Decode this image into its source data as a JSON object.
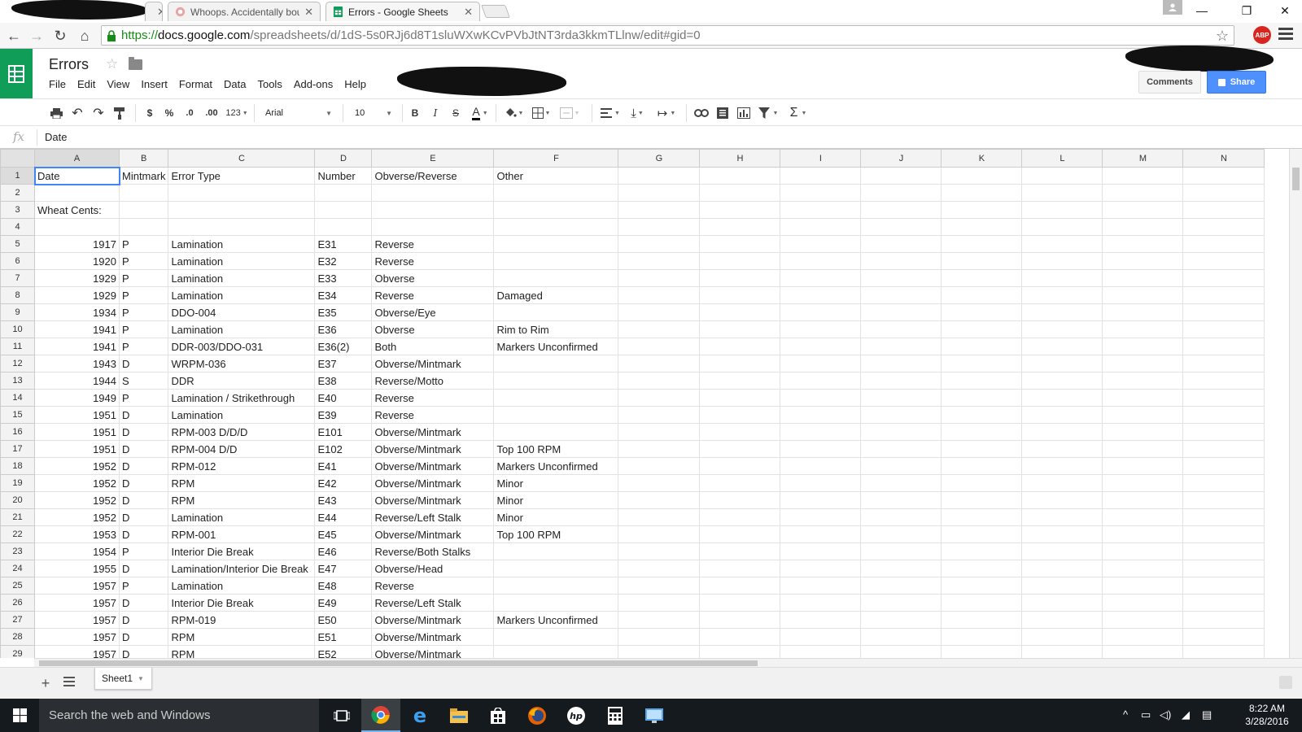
{
  "browser": {
    "tabs": [
      {
        "title": "",
        "redacted": true
      },
      {
        "title": "Whoops. Accidentally bou"
      },
      {
        "title": "Errors - Google Sheets",
        "active": true
      }
    ],
    "url": {
      "scheme": "https://",
      "host": "docs.google.com",
      "path": "/spreadsheets/d/1dS-5s0RJj6d8T1sluWXwKCvPVbJtNT3rda3kkmTLlnw/edit#gid=0"
    },
    "abp_label": "ABP"
  },
  "app": {
    "title": "Errors",
    "menu": [
      "File",
      "Edit",
      "View",
      "Insert",
      "Format",
      "Data",
      "Tools",
      "Add-ons",
      "Help"
    ],
    "comments_label": "Comments",
    "share_label": "Share",
    "brand_color": "#0f9d58",
    "share_color": "#4d90fe"
  },
  "toolbar": {
    "currency": "$",
    "percent": "%",
    "decrease_decimals": ".0",
    "increase_decimals": ".00",
    "more_formats": "123",
    "font": "Arial",
    "font_size": "10",
    "bold": "B",
    "italic": "I",
    "strikethrough": "S",
    "text_color": "A",
    "sum": "Σ"
  },
  "formula_bar": {
    "fx_label": "fx",
    "value": "Date"
  },
  "grid": {
    "columns": [
      "A",
      "B",
      "C",
      "D",
      "E",
      "F",
      "G",
      "H",
      "I",
      "J",
      "K",
      "L",
      "M",
      "N"
    ],
    "selected_cell": "A1",
    "rows": [
      {
        "n": "1",
        "cells": [
          "Date",
          "Mintmark",
          "Error Type",
          "Number",
          "Obverse/Reverse",
          "Other"
        ]
      },
      {
        "n": "2",
        "cells": [
          "",
          "",
          "",
          "",
          "",
          ""
        ]
      },
      {
        "n": "3",
        "cells": [
          "Wheat Cents:",
          "",
          "",
          "",
          "",
          ""
        ]
      },
      {
        "n": "4",
        "cells": [
          "",
          "",
          "",
          "",
          "",
          ""
        ]
      },
      {
        "n": "5",
        "cells": [
          "1917",
          "P",
          "Lamination",
          "E31",
          "Reverse",
          ""
        ]
      },
      {
        "n": "6",
        "cells": [
          "1920",
          "P",
          "Lamination",
          "E32",
          "Reverse",
          ""
        ]
      },
      {
        "n": "7",
        "cells": [
          "1929",
          "P",
          "Lamination",
          "E33",
          "Obverse",
          ""
        ]
      },
      {
        "n": "8",
        "cells": [
          "1929",
          "P",
          "Lamination",
          "E34",
          "Reverse",
          "Damaged"
        ]
      },
      {
        "n": "9",
        "cells": [
          "1934",
          "P",
          "DDO-004",
          "E35",
          "Obverse/Eye",
          ""
        ]
      },
      {
        "n": "10",
        "cells": [
          "1941",
          "P",
          "Lamination",
          "E36",
          "Obverse",
          "Rim to Rim"
        ]
      },
      {
        "n": "11",
        "cells": [
          "1941",
          "P",
          "DDR-003/DDO-031",
          "E36(2)",
          "Both",
          "Markers Unconfirmed"
        ]
      },
      {
        "n": "12",
        "cells": [
          "1943",
          "D",
          "WRPM-036",
          "E37",
          "Obverse/Mintmark",
          ""
        ]
      },
      {
        "n": "13",
        "cells": [
          "1944",
          "S",
          "DDR",
          "E38",
          "Reverse/Motto",
          ""
        ]
      },
      {
        "n": "14",
        "cells": [
          "1949",
          "P",
          "Lamination / Strikethrough",
          "E40",
          "Reverse",
          ""
        ]
      },
      {
        "n": "15",
        "cells": [
          "1951",
          "D",
          "Lamination",
          "E39",
          "Reverse",
          ""
        ]
      },
      {
        "n": "16",
        "cells": [
          "1951",
          "D",
          "RPM-003 D/D/D",
          "E101",
          "Obverse/Mintmark",
          ""
        ]
      },
      {
        "n": "17",
        "cells": [
          "1951",
          "D",
          "RPM-004 D/D",
          "E102",
          "Obverse/Mintmark",
          "Top 100 RPM"
        ]
      },
      {
        "n": "18",
        "cells": [
          "1952",
          "D",
          "RPM-012",
          "E41",
          "Obverse/Mintmark",
          "Markers Unconfirmed"
        ]
      },
      {
        "n": "19",
        "cells": [
          "1952",
          "D",
          "RPM",
          "E42",
          "Obverse/Mintmark",
          "Minor"
        ]
      },
      {
        "n": "20",
        "cells": [
          "1952",
          "D",
          "RPM",
          "E43",
          "Obverse/Mintmark",
          "Minor"
        ]
      },
      {
        "n": "21",
        "cells": [
          "1952",
          "D",
          "Lamination",
          "E44",
          "Reverse/Left Stalk",
          "Minor"
        ]
      },
      {
        "n": "22",
        "cells": [
          "1953",
          "D",
          "RPM-001",
          "E45",
          "Obverse/Mintmark",
          "Top 100 RPM"
        ]
      },
      {
        "n": "23",
        "cells": [
          "1954",
          "P",
          "Interior Die Break",
          "E46",
          "Reverse/Both Stalks",
          ""
        ]
      },
      {
        "n": "24",
        "cells": [
          "1955",
          "D",
          "Lamination/Interior Die Break",
          "E47",
          "Obverse/Head",
          ""
        ]
      },
      {
        "n": "25",
        "cells": [
          "1957",
          "P",
          "Lamination",
          "E48",
          "Reverse",
          ""
        ]
      },
      {
        "n": "26",
        "cells": [
          "1957",
          "D",
          "Interior Die Break",
          "E49",
          "Reverse/Left Stalk",
          ""
        ]
      },
      {
        "n": "27",
        "cells": [
          "1957",
          "D",
          "RPM-019",
          "E50",
          "Obverse/Mintmark",
          "Markers Unconfirmed"
        ]
      },
      {
        "n": "28",
        "cells": [
          "1957",
          "D",
          "RPM",
          "E51",
          "Obverse/Mintmark",
          ""
        ]
      },
      {
        "n": "29",
        "cells": [
          "1957",
          "D",
          "RPM",
          "E52",
          "Obverse/Mintmark",
          ""
        ]
      }
    ]
  },
  "sheets": {
    "tabs": [
      "Sheet1"
    ]
  },
  "taskbar": {
    "search_placeholder": "Search the web and Windows",
    "pinned": [
      "task-view-icon",
      "chrome-icon",
      "edge-icon",
      "file-explorer-icon",
      "store-icon",
      "firefox-icon",
      "hp-icon",
      "calculator-icon",
      "remote-desktop-icon"
    ],
    "time": "8:22 AM",
    "date": "3/28/2016"
  }
}
